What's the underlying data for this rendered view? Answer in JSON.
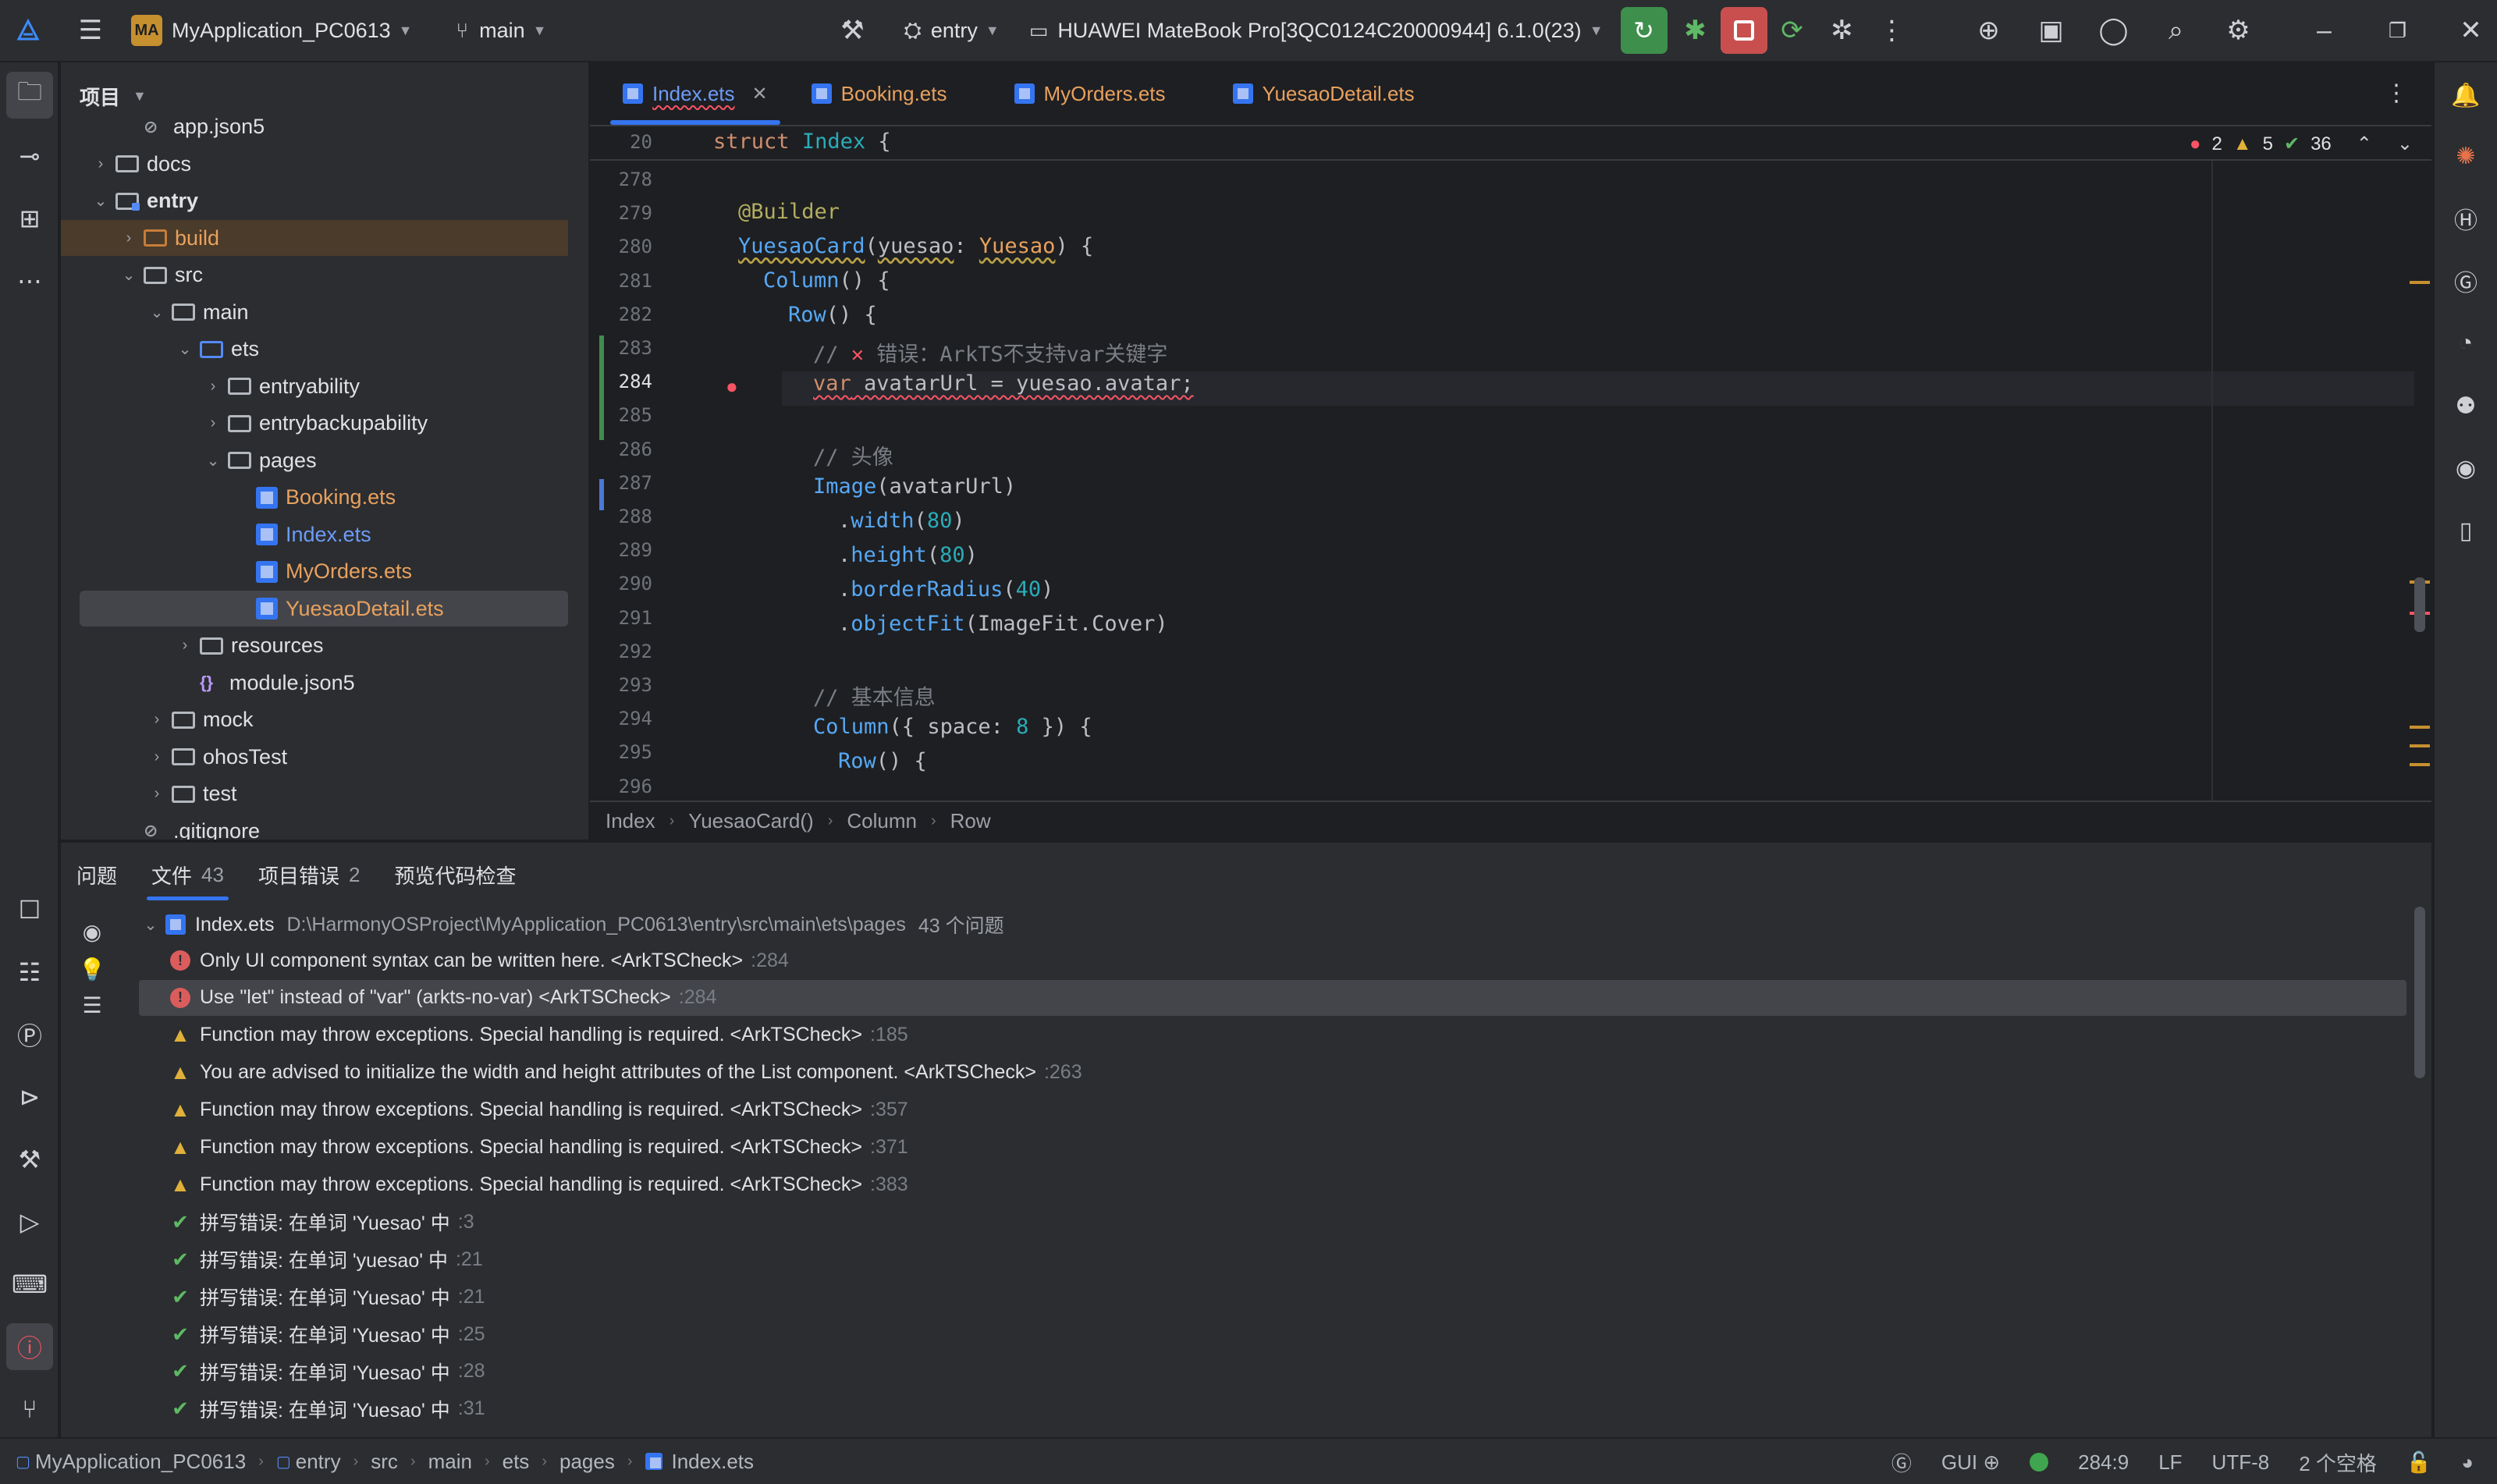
{
  "titlebar": {
    "project_badge": "MA",
    "project_name": "MyApplication_PC0613",
    "branch": "main",
    "run_config": "entry",
    "device": "HUAWEI MateBook Pro[3QC0124C20000944] 6.1.0(23)"
  },
  "project_panel": {
    "title": "项目",
    "tree": [
      {
        "label": "app.json5",
        "depth": 2,
        "kind": "file"
      },
      {
        "label": "docs",
        "depth": 1,
        "kind": "folder",
        "expanded": false
      },
      {
        "label": "entry",
        "depth": 1,
        "kind": "module",
        "expanded": true
      },
      {
        "label": "build",
        "depth": 2,
        "kind": "folder-orange",
        "expanded": false
      },
      {
        "label": "src",
        "depth": 2,
        "kind": "folder",
        "expanded": true
      },
      {
        "label": "main",
        "depth": 3,
        "kind": "folder",
        "expanded": true
      },
      {
        "label": "ets",
        "depth": 4,
        "kind": "folder-blue",
        "expanded": true
      },
      {
        "label": "entryability",
        "depth": 5,
        "kind": "folder",
        "expanded": false
      },
      {
        "label": "entrybackupability",
        "depth": 5,
        "kind": "folder",
        "expanded": false
      },
      {
        "label": "pages",
        "depth": 5,
        "kind": "folder",
        "expanded": true
      },
      {
        "label": "Booking.ets",
        "depth": 6,
        "kind": "ets"
      },
      {
        "label": "Index.ets",
        "depth": 6,
        "kind": "ets"
      },
      {
        "label": "MyOrders.ets",
        "depth": 6,
        "kind": "ets"
      },
      {
        "label": "YuesaoDetail.ets",
        "depth": 6,
        "kind": "ets"
      },
      {
        "label": "resources",
        "depth": 4,
        "kind": "folder",
        "expanded": false
      },
      {
        "label": "module.json5",
        "depth": 4,
        "kind": "json"
      },
      {
        "label": "mock",
        "depth": 3,
        "kind": "folder",
        "expanded": false
      },
      {
        "label": "ohosTest",
        "depth": 3,
        "kind": "folder",
        "expanded": false
      },
      {
        "label": "test",
        "depth": 3,
        "kind": "folder",
        "expanded": false
      },
      {
        "label": ".gitignore",
        "depth": 2,
        "kind": "file"
      }
    ]
  },
  "editor": {
    "tabs": [
      "Index.ets",
      "Booking.ets",
      "MyOrders.ets",
      "YuesaoDetail.ets"
    ],
    "active_tab": "Index.ets",
    "sticky_line": {
      "num": "20",
      "text": "struct Index {"
    },
    "inspections": {
      "errors": "2",
      "warnings": "5",
      "typos": "36"
    },
    "line_numbers": [
      "278",
      "279",
      "280",
      "281",
      "282",
      "283",
      "284",
      "285",
      "286",
      "287",
      "288",
      "289",
      "290",
      "291",
      "292",
      "293",
      "294",
      "295",
      "296"
    ],
    "breadcrumb": [
      "Index",
      "YuesaoCard()",
      "Column",
      "Row"
    ]
  },
  "problems": {
    "tabs": [
      {
        "label": "问题",
        "count": ""
      },
      {
        "label": "文件",
        "count": "43"
      },
      {
        "label": "项目错误",
        "count": "2"
      },
      {
        "label": "预览代码检查",
        "count": ""
      }
    ],
    "file_name": "Index.ets",
    "file_path": "D:\\HarmonyOSProject\\MyApplication_PC0613\\entry\\src\\main\\ets\\pages",
    "file_count": "43 个问题",
    "items": [
      {
        "level": "error",
        "text": "Only UI component syntax can be written here. <ArkTSCheck>",
        "line": ":284"
      },
      {
        "level": "error",
        "text": "Use \"let\" instead of \"var\" (arkts-no-var) <ArkTSCheck>",
        "line": ":284"
      },
      {
        "level": "warn",
        "text": "Function may throw exceptions. Special handling is required. <ArkTSCheck>",
        "line": ":185"
      },
      {
        "level": "warn",
        "text": "You are advised to initialize the width and height attributes of the List component. <ArkTSCheck>",
        "line": ":263"
      },
      {
        "level": "warn",
        "text": "Function may throw exceptions. Special handling is required. <ArkTSCheck>",
        "line": ":357"
      },
      {
        "level": "warn",
        "text": "Function may throw exceptions. Special handling is required. <ArkTSCheck>",
        "line": ":371"
      },
      {
        "level": "warn",
        "text": "Function may throw exceptions. Special handling is required. <ArkTSCheck>",
        "line": ":383"
      },
      {
        "level": "typo",
        "text": "拼写错误: 在单词 'Yuesao' 中",
        "line": ":3"
      },
      {
        "level": "typo",
        "text": "拼写错误: 在单词 'yuesao' 中",
        "line": ":21"
      },
      {
        "level": "typo",
        "text": "拼写错误: 在单词 'Yuesao' 中",
        "line": ":21"
      },
      {
        "level": "typo",
        "text": "拼写错误: 在单词 'Yuesao' 中",
        "line": ":25"
      },
      {
        "level": "typo",
        "text": "拼写错误: 在单词 'Yuesao' 中",
        "line": ":28"
      },
      {
        "level": "typo",
        "text": "拼写错误: 在单词 'Yuesao' 中",
        "line": ":31"
      }
    ]
  },
  "statusbar": {
    "crumbs": [
      "MyApplication_PC0613",
      "entry",
      "src",
      "main",
      "ets",
      "pages",
      "Index.ets"
    ],
    "gui": "GUI",
    "cursor": "284:9",
    "line_ending": "LF",
    "encoding": "UTF-8",
    "indent": "2 个空格"
  },
  "colors": {
    "accent": "#3574f0",
    "error": "#f75464",
    "warning": "#e0b03a",
    "ok": "#5fb865",
    "modified_file": "#e8a15e"
  }
}
